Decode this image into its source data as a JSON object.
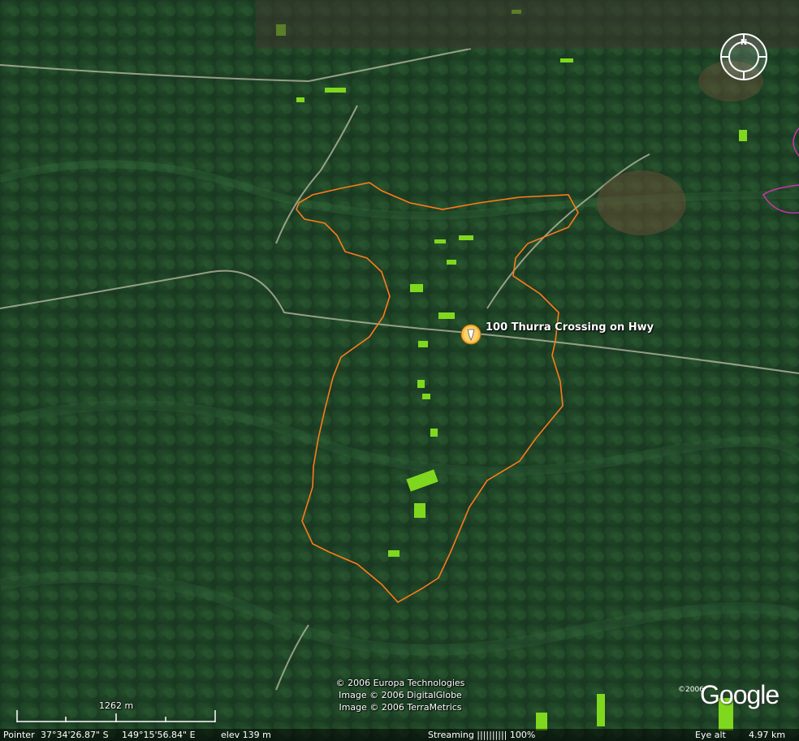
{
  "map": {
    "placemark_label": "100 Thurra Crossing on Hwy",
    "copyright_lines": [
      "© 2006 Europa Technologies",
      "Image © 2006 DigitalGlobe",
      "Image © 2006 TerraMetrics"
    ],
    "scale_label": "1262 m",
    "logo_text": "Google",
    "logo_year": "©2006"
  },
  "status": {
    "pointer_label": "Pointer",
    "lat": "37°34'26.87\"  S",
    "lon": "149°15'56.84\"  E",
    "elev": "elev  139 m",
    "streaming": "Streaming |||||||||| 100%",
    "eye_alt_label": "Eye alt",
    "eye_alt_value": "4.97 km"
  },
  "colors": {
    "boundary": "#ff7a1a",
    "highlight": "#7fd81e",
    "road": "#c9c7b0",
    "forest_dark": "#17361d",
    "forest_mid": "#2a5a31"
  },
  "icons": {
    "placemark": "pushpin-icon",
    "compass": "compass-icon"
  }
}
